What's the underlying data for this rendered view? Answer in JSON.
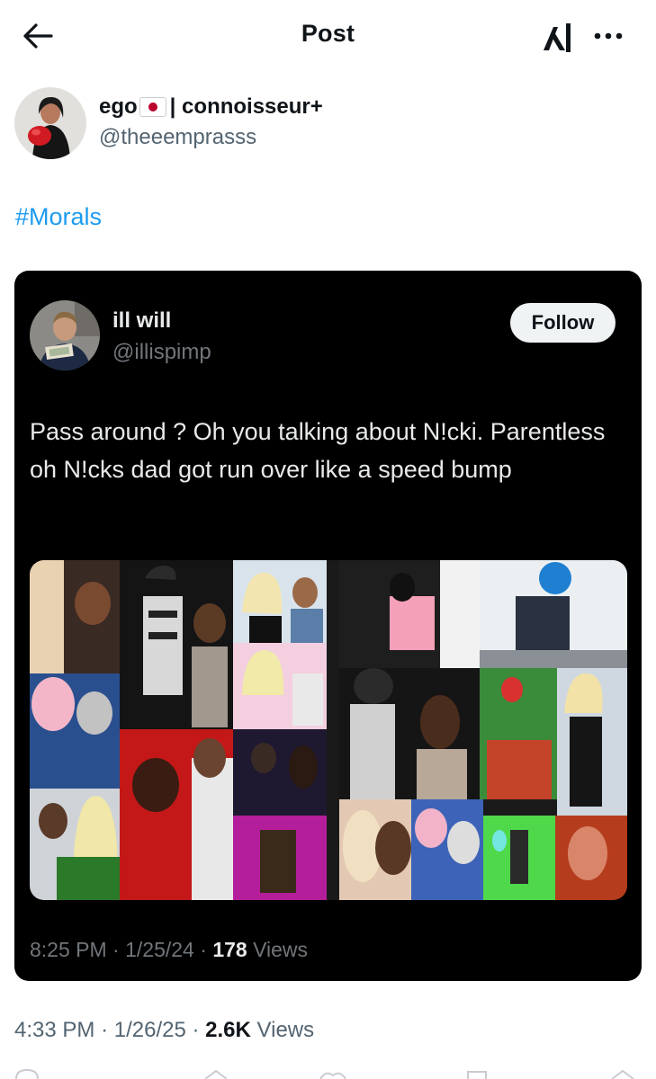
{
  "header": {
    "title": "Post"
  },
  "post": {
    "author_name": "ego",
    "author_name_suffix": "| connoisseur+",
    "author_handle": "@theeemprasss",
    "hashtag": "#Morals",
    "time": "4:33 PM",
    "date": "1/26/25",
    "views_count": "2.6K",
    "views_label": "Views"
  },
  "quoted": {
    "author_name": "ill will",
    "author_handle": "@illispimp",
    "follow_label": "Follow",
    "text": "Pass around ? Oh you talking about N!cki. Parentless oh N!cks dad got run over like a speed bump",
    "time": "8:25 PM",
    "date": "1/25/24",
    "views_count": "178",
    "views_label": "Views"
  },
  "meta_separator": "·",
  "icons": {
    "back": "back-arrow-icon",
    "grok": "grok-icon",
    "more": "more-icon",
    "flag": "japan-flag-icon"
  },
  "colors": {
    "link": "#1d9bf0",
    "secondary_text": "#536471",
    "card_background": "#000000",
    "follow_button": "#eff3f4"
  }
}
